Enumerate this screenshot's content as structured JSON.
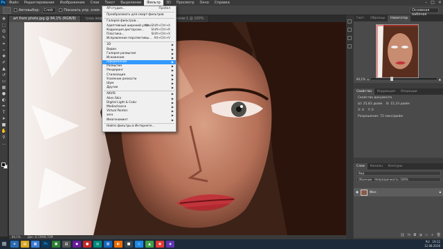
{
  "menubar": {
    "items": [
      "Файл",
      "Редактирование",
      "Изображение",
      "Слои",
      "Текст",
      "Выделение",
      "Фильтр",
      "3D",
      "Просмотр",
      "Окно",
      "Справка"
    ],
    "active_index": 6
  },
  "options": {
    "autoselect_label": "Автовыбор:",
    "autoselect_value": "Слой",
    "transform_label": "Показать упр. элем.",
    "workspace": "Основная рабочая"
  },
  "tabs": [
    {
      "label": "art from photo.jpg @ 84,1% (RGB/8)",
      "active": true
    },
    {
      "label": "тушь видео мозаика.jpg @ 50% (RGB/8)",
      "active": false
    },
    {
      "label": "Без имени-1 @ 100%",
      "active": false
    }
  ],
  "filter_menu": {
    "items": [
      {
        "label": "AP-студия...",
        "shortcut": "Пробел"
      },
      {
        "sep": true
      },
      {
        "label": "Преобразовать для смарт-фильтров"
      },
      {
        "sep": true
      },
      {
        "label": "Галерея фильтров..."
      },
      {
        "label": "Адаптивный широкий угол...",
        "shortcut": "Alt+Shift+Ctrl+A"
      },
      {
        "label": "Коррекция дисторсии...",
        "shortcut": "Shift+Ctrl+R"
      },
      {
        "label": "Пластика...",
        "shortcut": "Shift+Ctrl+X"
      },
      {
        "label": "Исправление перспективы...",
        "shortcut": "Alt+Ctrl+V"
      },
      {
        "sep": true
      },
      {
        "label": "3D",
        "sub": true
      },
      {
        "label": "Видео",
        "sub": true
      },
      {
        "label": "Галерея размытия",
        "sub": true
      },
      {
        "label": "Искажение",
        "sub": true
      },
      {
        "label": "Оформление",
        "sub": true,
        "highlight": true
      },
      {
        "label": "Размытие",
        "sub": true
      },
      {
        "label": "Рендеринг",
        "sub": true
      },
      {
        "label": "Стилизация",
        "sub": true
      },
      {
        "label": "Усиление резкости",
        "sub": true
      },
      {
        "label": "Шум",
        "sub": true
      },
      {
        "label": "Другие",
        "sub": true
      },
      {
        "sep": true
      },
      {
        "label": "AKVIS",
        "sub": true
      },
      {
        "label": "Alien Skin",
        "sub": true
      },
      {
        "label": "Digital Light & Color",
        "sub": true
      },
      {
        "label": "Mediachance",
        "sub": true
      },
      {
        "label": "Virtual Painter",
        "sub": true
      },
      {
        "label": "xero",
        "sub": true
      },
      {
        "label": "Имагеноминт",
        "sub": true
      },
      {
        "sep": true
      },
      {
        "label": "Найти фильтры в Интернете..."
      }
    ]
  },
  "status": {
    "zoom": "84,1%",
    "doc": "Док: 8,72M/8,72M"
  },
  "navigator": {
    "tabs": [
      "Гист.",
      "Образцы",
      "Навигатор"
    ],
    "active_tab": 2,
    "zoom": "84,1%"
  },
  "properties": {
    "tabs": [
      "Свойства",
      "Коррекция",
      "Операции"
    ],
    "title": "Свойства документа",
    "width": "Ш: 25,83 дюйм",
    "height": "В: 15,33 дюйм",
    "x": "X: 0",
    "y": "Y: 0",
    "resolution": "Разрешение: 72 пикс/дюйм"
  },
  "layers": {
    "tabs": [
      "Слои",
      "Каналы",
      "Контуры"
    ],
    "kind_label": "Вид",
    "blend_mode": "Обычные",
    "opacity": "Непрозрачность: 100%",
    "lock_label": "Закрепить:",
    "fill": "Заливка: 100%",
    "layer_name": "Фон"
  },
  "taskbar": {
    "time": "19:12",
    "date": "12.08.2016",
    "lang": "RU"
  },
  "colors": {
    "highlight": "#3399ff",
    "menubar": "#3a3a3a",
    "panel": "#4a4a4a"
  }
}
